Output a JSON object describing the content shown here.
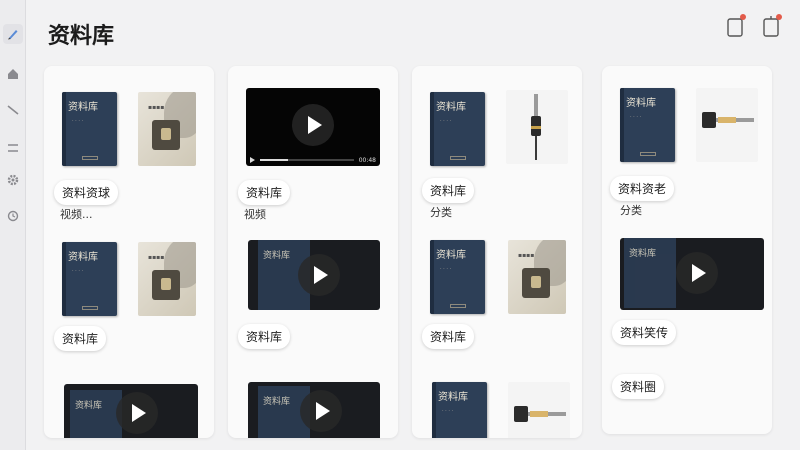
{
  "header": {
    "title": "资料库"
  },
  "sidebar": {
    "items": [
      "edit-icon",
      "home-icon",
      "tool-icon",
      "menu-icon",
      "settings-icon",
      "history-icon"
    ]
  },
  "book_cover": {
    "title": "资料库"
  },
  "video": {
    "duration": "00:48"
  },
  "columns": [
    {
      "tags": [
        "资料资球",
        "资料库"
      ],
      "subs": [
        "视频..."
      ]
    },
    {
      "tags": [
        "资料库",
        "资料库"
      ],
      "subs": [
        "视频"
      ]
    },
    {
      "tags": [
        "资料库",
        "资料库"
      ],
      "subs": [
        "分类"
      ]
    },
    {
      "tags": [
        "资料资老",
        "资料笑传",
        "资料圈"
      ],
      "subs": [
        "分类"
      ]
    }
  ]
}
